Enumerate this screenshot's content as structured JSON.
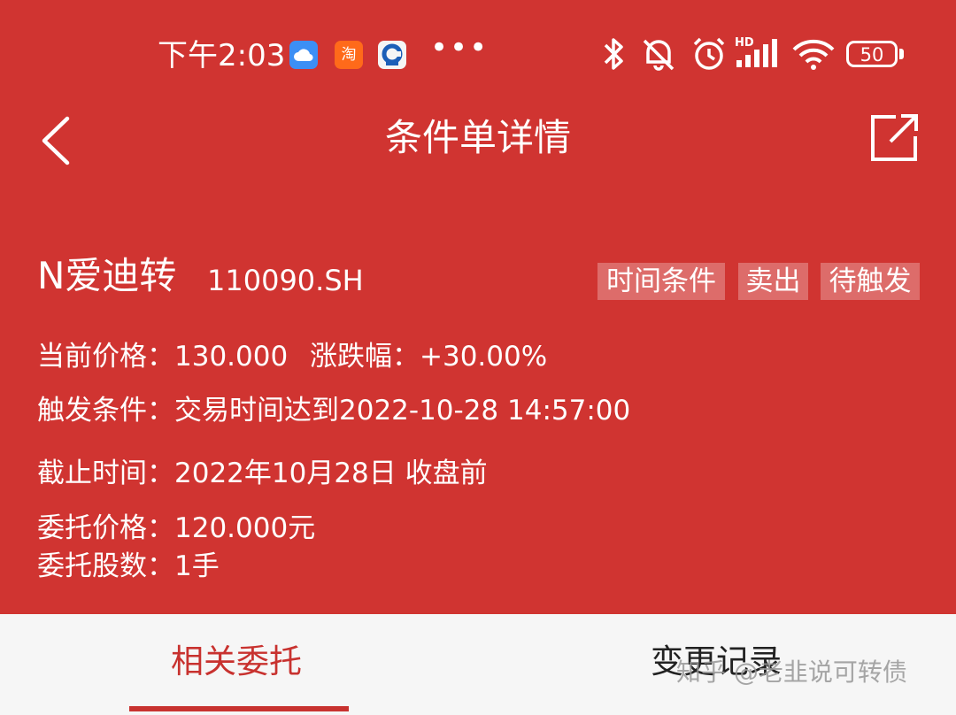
{
  "status_bar": {
    "time": "下午2:03",
    "taobao_label": "淘",
    "more": "•••",
    "battery": "50"
  },
  "nav": {
    "title": "条件单详情"
  },
  "stock": {
    "name": "N爱迪转",
    "code": "110090.SH",
    "tags": [
      "时间条件",
      "卖出",
      "待触发"
    ]
  },
  "details": {
    "current_price": "当前价格：130.000",
    "change": "涨跌幅：+30.00%",
    "trigger": "触发条件：交易时间达到2022-10-28 14:57:00",
    "deadline": "截止时间：2022年10月28日 收盘前",
    "order_price": "委托价格：120.000元",
    "order_qty": "委托股数：1手"
  },
  "tabs": {
    "related": "相关委托",
    "history": "变更记录"
  },
  "watermark": "知乎 @老韭说可转债",
  "colors": {
    "background": "#d03431",
    "accent": "#c8322f",
    "tab_bar": "#f6f6f6"
  }
}
